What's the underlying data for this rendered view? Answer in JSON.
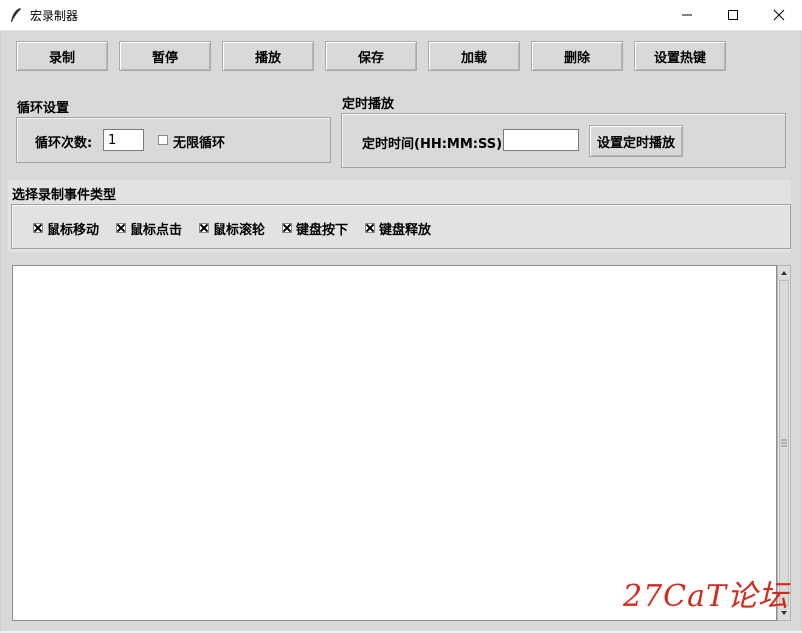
{
  "window": {
    "title": "宏录制器",
    "controls": {
      "minimize": "minimize-icon",
      "maximize": "maximize-icon",
      "close": "close-icon"
    }
  },
  "toolbar": {
    "buttons": [
      "录制",
      "暂停",
      "播放",
      "保存",
      "加载",
      "删除",
      "设置热键"
    ]
  },
  "loop": {
    "section_title": "循环设置",
    "count_label": "循环次数:",
    "count_value": "1",
    "infinite_label": "无限循环",
    "infinite_checked": false
  },
  "timer": {
    "section_title": "定时播放",
    "time_label": "定时时间(HH:MM:SS):",
    "time_value": "",
    "set_button": "设置定时播放"
  },
  "events": {
    "section_title": "选择录制事件类型",
    "items": [
      {
        "label": "鼠标移动",
        "checked": true
      },
      {
        "label": "鼠标点击",
        "checked": true
      },
      {
        "label": "鼠标滚轮",
        "checked": true
      },
      {
        "label": "键盘按下",
        "checked": true
      },
      {
        "label": "键盘释放",
        "checked": true
      }
    ]
  },
  "log": {
    "text": ""
  },
  "watermark": "27CaT论坛",
  "colors": {
    "window_bg": "#d9d9d9",
    "watermark": "#d42a1e"
  }
}
